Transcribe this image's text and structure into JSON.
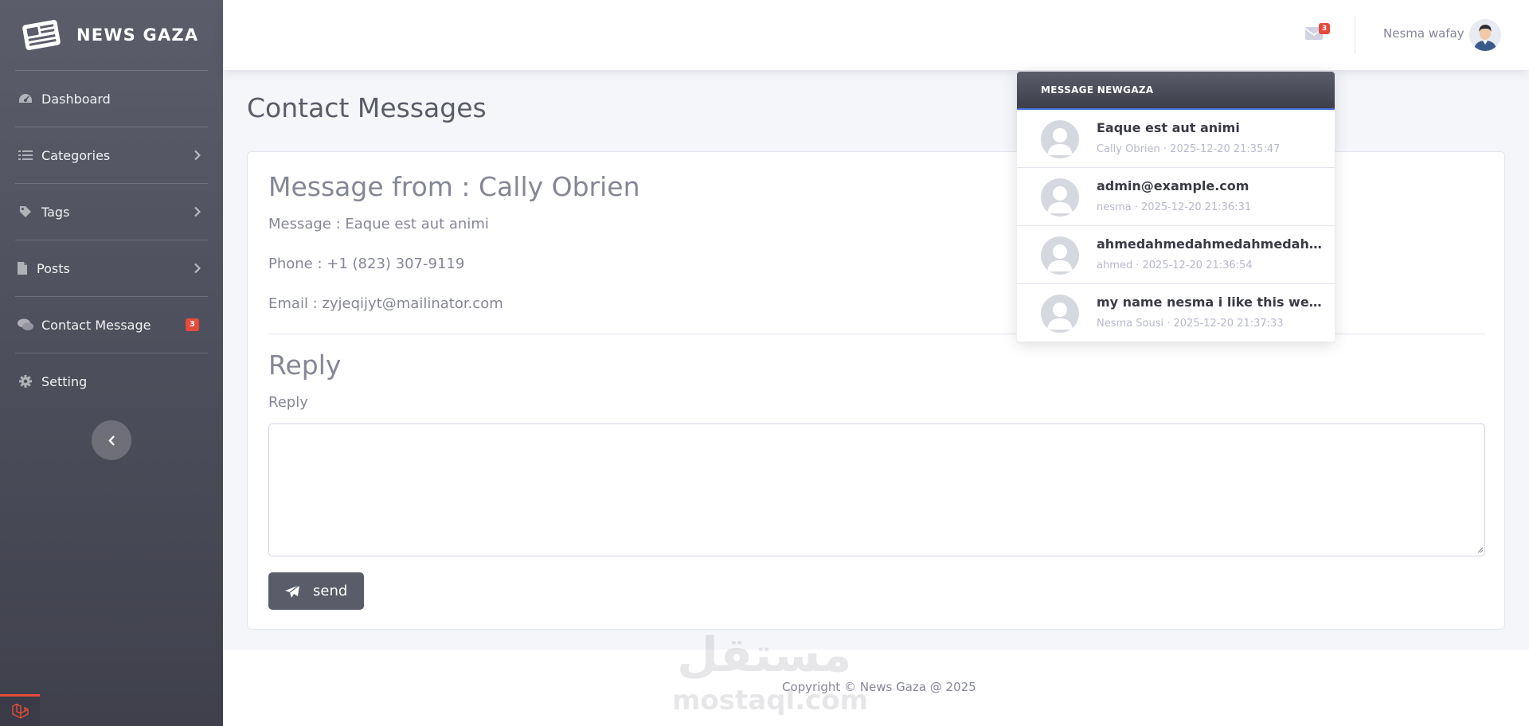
{
  "brand": {
    "name": "NEWS GAZA"
  },
  "sidebar": {
    "items": [
      {
        "label": "Dashboard"
      },
      {
        "label": "Categories"
      },
      {
        "label": "Tags"
      },
      {
        "label": "Posts"
      },
      {
        "label": "Contact Message",
        "badge": "3"
      },
      {
        "label": "Setting"
      }
    ]
  },
  "topbar": {
    "mail_badge": "3",
    "user_name": "Nesma wafay"
  },
  "page": {
    "title": "Contact Messages"
  },
  "message": {
    "from": "Message from : Cally Obrien",
    "body": "Message : Eaque est aut animi",
    "phone": "Phone : +1 (823) 307-9119",
    "email": "Email : zyjeqijyt@mailinator.com"
  },
  "reply": {
    "title": "Reply",
    "label": "Reply",
    "value": "",
    "send_label": "send"
  },
  "dropdown": {
    "header": "MESSAGE NEWGAZA",
    "items": [
      {
        "title": "Eaque est aut animi",
        "sub": "Cally Obrien · 2025-12-20 21:35:47"
      },
      {
        "title": "admin@example.com",
        "sub": "nesma · 2025-12-20 21:36:31"
      },
      {
        "title": "ahmedahmedahmedahmedahm...",
        "sub": "ahmed · 2025-12-20 21:36:54"
      },
      {
        "title": "my name nesma i like this websi...",
        "sub": "Nesma Sousi · 2025-12-20 21:37:33"
      }
    ]
  },
  "footer": {
    "text": "Copyright © News Gaza @ 2025",
    "watermark_ar": "مستقل",
    "watermark_en": "mostaql.com"
  },
  "colors": {
    "sidebar_top": "#5b5d6b",
    "sidebar_bottom": "#3f404c",
    "badge": "#e74a3b",
    "button": "#5a5c69"
  }
}
